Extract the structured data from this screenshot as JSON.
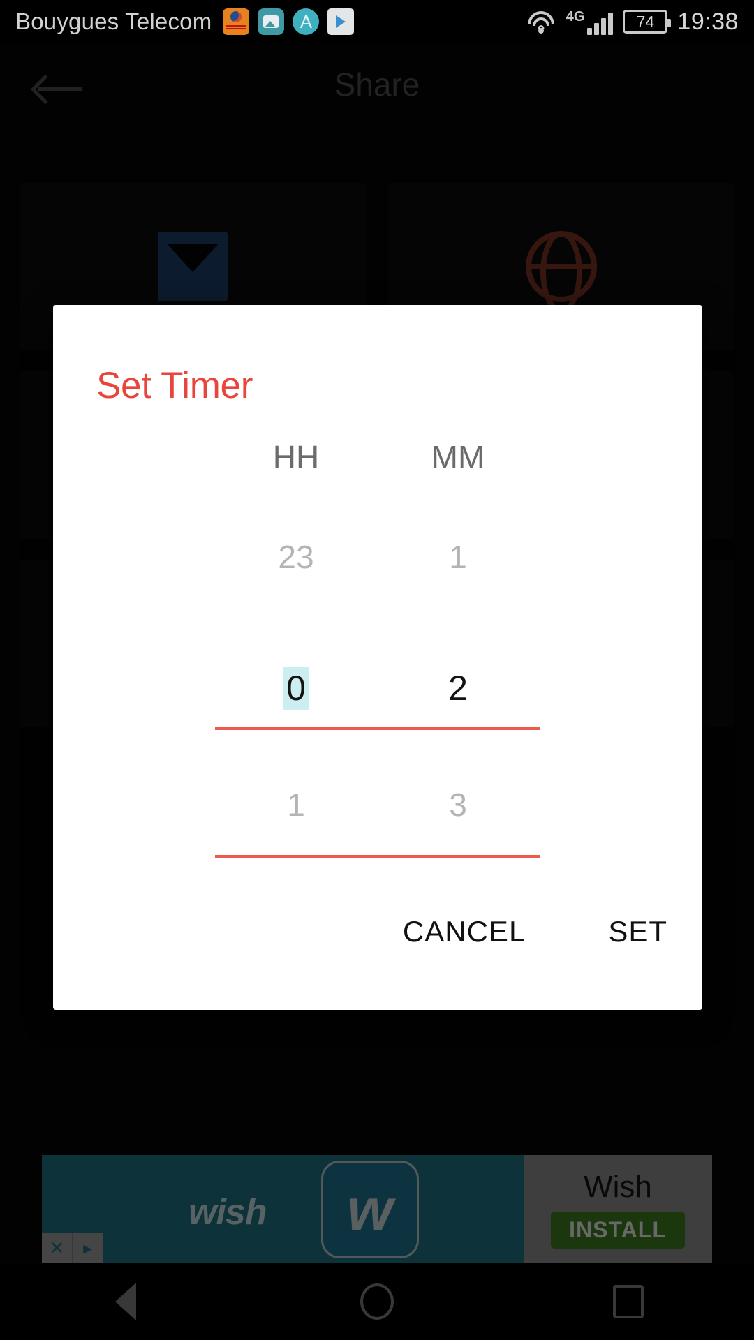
{
  "status_bar": {
    "carrier": "Bouygues Telecom",
    "notification_icons": [
      "orange-app-icon",
      "gallery-icon",
      "a-circle-icon",
      "play-store-icon"
    ],
    "wifi_icon": "wifi-icon",
    "network_type": "4G",
    "signal_icon": "signal-bars-icon",
    "battery_level": "74",
    "clock": "19:38"
  },
  "app": {
    "back_icon": "back-arrow-icon",
    "title": "Share",
    "share_targets": [
      {
        "icon": "email-icon"
      },
      {
        "icon": "browser-globe-icon"
      },
      {
        "icon": "blank-target-icon"
      },
      {
        "icon": "blank-target-icon"
      },
      {
        "icon": "blank-target-icon"
      },
      {
        "icon": "blank-target-icon"
      }
    ]
  },
  "dialog": {
    "title": "Set Timer",
    "accent_color": "#e8453c",
    "rule_color": "#ef5a4f",
    "selection_highlight_color": "#cdeef0",
    "columns": [
      {
        "key": "hours",
        "label": "HH",
        "above": "23",
        "current": "0",
        "below": "1",
        "selected": true
      },
      {
        "key": "minutes",
        "label": "MM",
        "above": "1",
        "current": "2",
        "below": "3",
        "selected": false
      }
    ],
    "cancel_label": "CANCEL",
    "set_label": "SET"
  },
  "ad": {
    "brand_word": "wish",
    "app_icon_letter": "w",
    "app_name": "Wish",
    "install_label": "INSTALL",
    "close_icon": "close-x-icon",
    "adchoices_icon": "adchoices-icon"
  },
  "nav_bar": {
    "back_icon": "nav-back-triangle-icon",
    "home_icon": "nav-home-circle-icon",
    "recents_icon": "nav-recents-square-icon"
  }
}
